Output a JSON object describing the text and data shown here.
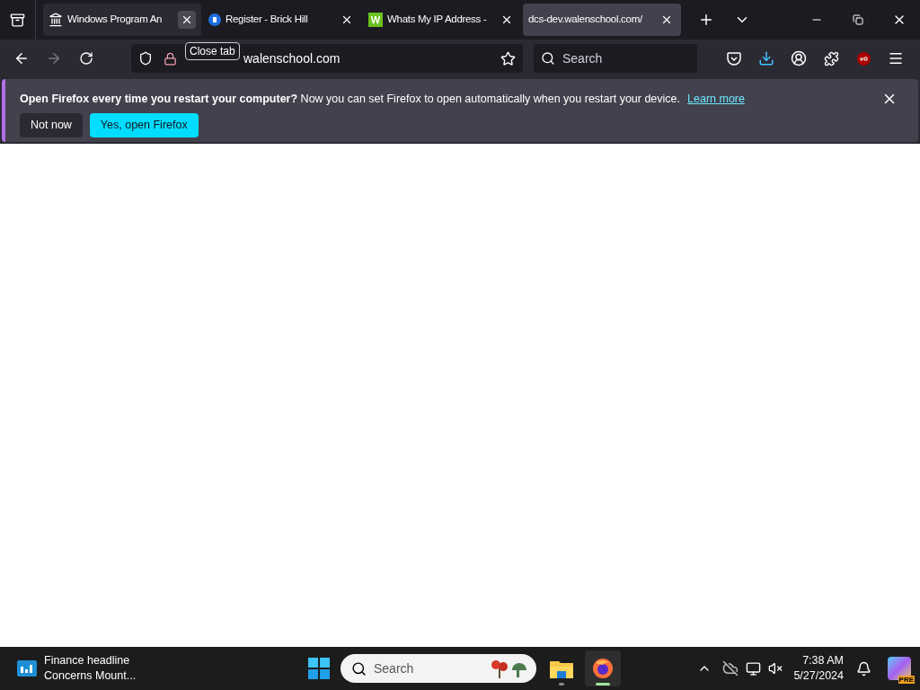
{
  "tabs": [
    {
      "title": "Windows Program An",
      "kind": "columns",
      "selected": false,
      "hovered": true
    },
    {
      "title": "Register - Brick Hill",
      "kind": "brickhill",
      "selected": false,
      "hovered": false
    },
    {
      "title": "Whats My IP Address -",
      "kind": "lettered",
      "favicon_letter": "W",
      "selected": false,
      "hovered": false
    },
    {
      "title": "dcs-dev.walenschool.com/",
      "kind": "plain",
      "selected": true,
      "hovered": false
    }
  ],
  "tooltip": "Close tab",
  "url": "walenschool.com",
  "search": {
    "placeholder": "Search"
  },
  "notification": {
    "message": "**Open Firefox every time you restart your computer?** Now you can set Firefox to open automatically when you restart your device.",
    "link": "Learn more",
    "buttons": [
      {
        "label": "Not now",
        "kind": "secondary"
      },
      {
        "label": "Yes, open Firefox",
        "kind": "primary"
      }
    ]
  },
  "taskbar": {
    "widget_title": "Finance headline",
    "widget_subtitle": "Concerns Mount...",
    "search": {
      "placeholder": "Search"
    },
    "apps": [
      {
        "kind": "files",
        "active": false
      },
      {
        "kind": "firefox",
        "active": true
      }
    ],
    "time": "7:38 AM",
    "date": "5/27/2024",
    "copilot_badge": "PRE"
  }
}
